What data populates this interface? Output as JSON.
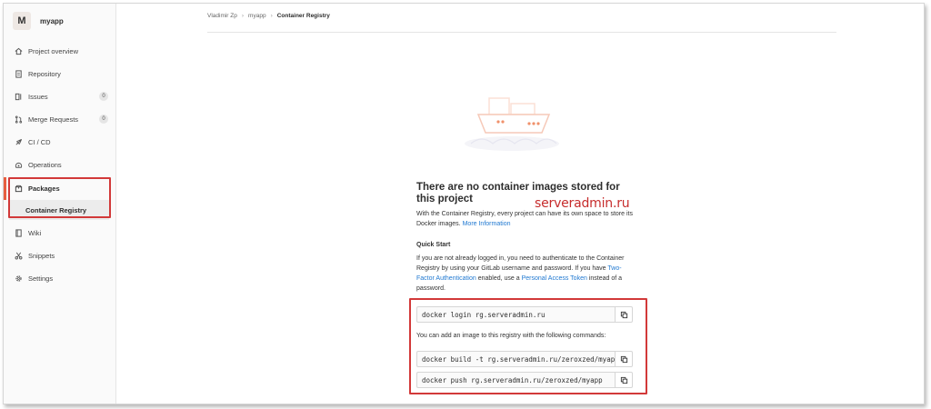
{
  "project": {
    "avatar_letter": "M",
    "name": "myapp"
  },
  "sidebar": {
    "items": [
      {
        "label": "Project overview",
        "icon": "home-icon"
      },
      {
        "label": "Repository",
        "icon": "doc-icon"
      },
      {
        "label": "Issues",
        "icon": "issues-icon",
        "badge": "0"
      },
      {
        "label": "Merge Requests",
        "icon": "merge-icon",
        "badge": "0"
      },
      {
        "label": "CI / CD",
        "icon": "rocket-icon"
      },
      {
        "label": "Operations",
        "icon": "cloud-icon"
      }
    ],
    "packages": {
      "label": "Packages",
      "icon": "package-icon",
      "sub_label": "Container Registry"
    },
    "items_after": [
      {
        "label": "Wiki",
        "icon": "book-icon"
      },
      {
        "label": "Snippets",
        "icon": "scissors-icon"
      },
      {
        "label": "Settings",
        "icon": "gear-icon"
      }
    ]
  },
  "breadcrumb": {
    "user": "Vladimir Zp",
    "project": "myapp",
    "current": "Container Registry"
  },
  "empty_state": {
    "title": "There are no container images stored for this project",
    "description": "With the Container Registry, every project can have its own space to store its Docker images.",
    "more_info_link": "More Information",
    "quick_start_title": "Quick Start",
    "quick_start_text_1": "If you are not already logged in, you need to authenticate to the Container Registry by using your GitLab username and password. If you have",
    "two_factor_link": "Two-Factor Authentication",
    "quick_start_text_2": "enabled, use a",
    "pat_link": "Personal Access Token",
    "quick_start_text_3": "instead of a password."
  },
  "watermark": "serveradmin.ru",
  "commands": {
    "login": "docker login rg.serveradmin.ru",
    "note": "You can add an image to this registry with the following commands:",
    "build": "docker build -t rg.serveradmin.ru/zeroxzed/myapp .",
    "push": "docker push rg.serveradmin.ru/zeroxzed/myapp"
  },
  "colors": {
    "accent": "#e75e40",
    "link": "#1f78d1",
    "highlight": "#d23939"
  }
}
